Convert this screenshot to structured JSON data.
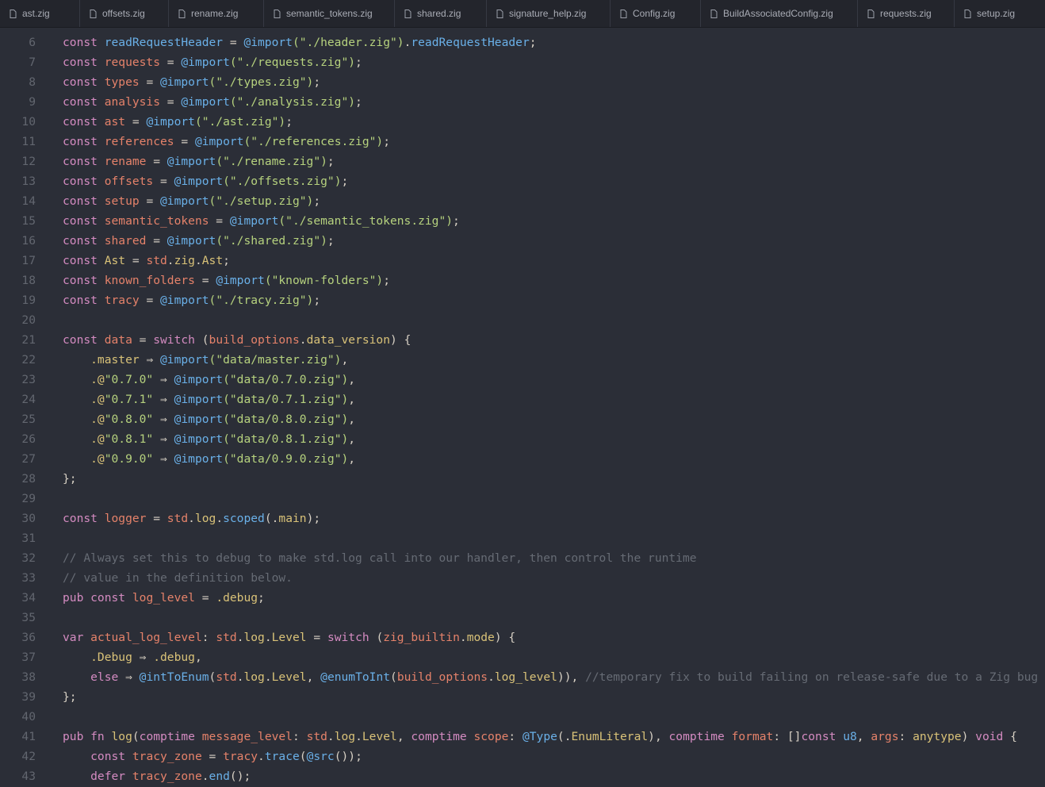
{
  "tabs": [
    {
      "label": "ast.zig"
    },
    {
      "label": "offsets.zig"
    },
    {
      "label": "rename.zig"
    },
    {
      "label": "semantic_tokens.zig"
    },
    {
      "label": "shared.zig"
    },
    {
      "label": "signature_help.zig"
    },
    {
      "label": "Config.zig"
    },
    {
      "label": "BuildAssociatedConfig.zig"
    },
    {
      "label": "requests.zig"
    },
    {
      "label": "setup.zig"
    }
  ],
  "colors": {
    "background": "#2b2e37",
    "tabbar": "#23252c",
    "keyword": "#d48bc1",
    "variable": "#e5826a",
    "function": "#6ab0e8",
    "string": "#b6d27e",
    "comment": "#666b74",
    "line_number": "#62666f"
  },
  "icons": {
    "tab_file": "file-icon"
  },
  "editor": {
    "lines": [
      {
        "n": "6",
        "tokens": [
          [
            "const ",
            "k"
          ],
          [
            "readRequestHeader",
            "f"
          ],
          [
            " = ",
            "p"
          ],
          [
            "@import",
            "f"
          ],
          [
            "(\"./header.zig\")",
            "s"
          ],
          [
            ".",
            "p"
          ],
          [
            "readRequestHeader",
            "f"
          ],
          [
            ";",
            "p"
          ]
        ]
      },
      {
        "n": "7",
        "tokens": [
          [
            "const ",
            "k"
          ],
          [
            "requests",
            "v"
          ],
          [
            " = ",
            "p"
          ],
          [
            "@import",
            "f"
          ],
          [
            "(\"./requests.zig\")",
            "s"
          ],
          [
            ";",
            "p"
          ]
        ]
      },
      {
        "n": "8",
        "tokens": [
          [
            "const ",
            "k"
          ],
          [
            "types",
            "v"
          ],
          [
            " = ",
            "p"
          ],
          [
            "@import",
            "f"
          ],
          [
            "(\"./types.zig\")",
            "s"
          ],
          [
            ";",
            "p"
          ]
        ]
      },
      {
        "n": "9",
        "tokens": [
          [
            "const ",
            "k"
          ],
          [
            "analysis",
            "v"
          ],
          [
            " = ",
            "p"
          ],
          [
            "@import",
            "f"
          ],
          [
            "(\"./analysis.zig\")",
            "s"
          ],
          [
            ";",
            "p"
          ]
        ]
      },
      {
        "n": "10",
        "tokens": [
          [
            "const ",
            "k"
          ],
          [
            "ast",
            "v"
          ],
          [
            " = ",
            "p"
          ],
          [
            "@import",
            "f"
          ],
          [
            "(\"./ast.zig\")",
            "s"
          ],
          [
            ";",
            "p"
          ]
        ]
      },
      {
        "n": "11",
        "tokens": [
          [
            "const ",
            "k"
          ],
          [
            "references",
            "v"
          ],
          [
            " = ",
            "p"
          ],
          [
            "@import",
            "f"
          ],
          [
            "(\"./references.zig\")",
            "s"
          ],
          [
            ";",
            "p"
          ]
        ]
      },
      {
        "n": "12",
        "tokens": [
          [
            "const ",
            "k"
          ],
          [
            "rename",
            "v"
          ],
          [
            " = ",
            "p"
          ],
          [
            "@import",
            "f"
          ],
          [
            "(\"./rename.zig\")",
            "s"
          ],
          [
            ";",
            "p"
          ]
        ]
      },
      {
        "n": "13",
        "tokens": [
          [
            "const ",
            "k"
          ],
          [
            "offsets",
            "v"
          ],
          [
            " = ",
            "p"
          ],
          [
            "@import",
            "f"
          ],
          [
            "(\"./offsets.zig\")",
            "s"
          ],
          [
            ";",
            "p"
          ]
        ]
      },
      {
        "n": "14",
        "tokens": [
          [
            "const ",
            "k"
          ],
          [
            "setup",
            "v"
          ],
          [
            " = ",
            "p"
          ],
          [
            "@import",
            "f"
          ],
          [
            "(\"./setup.zig\")",
            "s"
          ],
          [
            ";",
            "p"
          ]
        ]
      },
      {
        "n": "15",
        "tokens": [
          [
            "const ",
            "k"
          ],
          [
            "semantic_tokens",
            "v"
          ],
          [
            " = ",
            "p"
          ],
          [
            "@import",
            "f"
          ],
          [
            "(\"./semantic_tokens.zig\")",
            "s"
          ],
          [
            ";",
            "p"
          ]
        ]
      },
      {
        "n": "16",
        "tokens": [
          [
            "const ",
            "k"
          ],
          [
            "shared",
            "v"
          ],
          [
            " = ",
            "p"
          ],
          [
            "@import",
            "f"
          ],
          [
            "(\"./shared.zig\")",
            "s"
          ],
          [
            ";",
            "p"
          ]
        ]
      },
      {
        "n": "17",
        "tokens": [
          [
            "const ",
            "k"
          ],
          [
            "Ast",
            "t"
          ],
          [
            " = ",
            "p"
          ],
          [
            "std",
            "v"
          ],
          [
            ".",
            "p"
          ],
          [
            "zig",
            "t"
          ],
          [
            ".",
            "p"
          ],
          [
            "Ast",
            "t"
          ],
          [
            ";",
            "p"
          ]
        ]
      },
      {
        "n": "18",
        "tokens": [
          [
            "const ",
            "k"
          ],
          [
            "known_folders",
            "v"
          ],
          [
            " = ",
            "p"
          ],
          [
            "@import",
            "f"
          ],
          [
            "(\"known-folders\")",
            "s"
          ],
          [
            ";",
            "p"
          ]
        ]
      },
      {
        "n": "19",
        "tokens": [
          [
            "const ",
            "k"
          ],
          [
            "tracy",
            "v"
          ],
          [
            " = ",
            "p"
          ],
          [
            "@import",
            "f"
          ],
          [
            "(\"./tracy.zig\")",
            "s"
          ],
          [
            ";",
            "p"
          ]
        ]
      },
      {
        "n": "20",
        "tokens": []
      },
      {
        "n": "21",
        "tokens": [
          [
            "const ",
            "k"
          ],
          [
            "data",
            "v"
          ],
          [
            " = ",
            "p"
          ],
          [
            "switch",
            "k"
          ],
          [
            " (",
            "p"
          ],
          [
            "build_options",
            "v"
          ],
          [
            ".",
            "p"
          ],
          [
            "data_version",
            "t"
          ],
          [
            ") {",
            "p"
          ]
        ]
      },
      {
        "n": "22",
        "tokens": [
          [
            "    .master",
            "t"
          ],
          [
            " ⇒ ",
            "p"
          ],
          [
            "@import",
            "f"
          ],
          [
            "(\"data/master.zig\")",
            "s"
          ],
          [
            ",",
            "p"
          ]
        ]
      },
      {
        "n": "23",
        "tokens": [
          [
            "    .@",
            "t"
          ],
          [
            "\"0.7.0\"",
            "s"
          ],
          [
            " ⇒ ",
            "p"
          ],
          [
            "@import",
            "f"
          ],
          [
            "(\"data/0.7.0.zig\")",
            "s"
          ],
          [
            ",",
            "p"
          ]
        ]
      },
      {
        "n": "24",
        "tokens": [
          [
            "    .@",
            "t"
          ],
          [
            "\"0.7.1\"",
            "s"
          ],
          [
            " ⇒ ",
            "p"
          ],
          [
            "@import",
            "f"
          ],
          [
            "(\"data/0.7.1.zig\")",
            "s"
          ],
          [
            ",",
            "p"
          ]
        ]
      },
      {
        "n": "25",
        "tokens": [
          [
            "    .@",
            "t"
          ],
          [
            "\"0.8.0\"",
            "s"
          ],
          [
            " ⇒ ",
            "p"
          ],
          [
            "@import",
            "f"
          ],
          [
            "(\"data/0.8.0.zig\")",
            "s"
          ],
          [
            ",",
            "p"
          ]
        ]
      },
      {
        "n": "26",
        "tokens": [
          [
            "    .@",
            "t"
          ],
          [
            "\"0.8.1\"",
            "s"
          ],
          [
            " ⇒ ",
            "p"
          ],
          [
            "@import",
            "f"
          ],
          [
            "(\"data/0.8.1.zig\")",
            "s"
          ],
          [
            ",",
            "p"
          ]
        ]
      },
      {
        "n": "27",
        "tokens": [
          [
            "    .@",
            "t"
          ],
          [
            "\"0.9.0\"",
            "s"
          ],
          [
            " ⇒ ",
            "p"
          ],
          [
            "@import",
            "f"
          ],
          [
            "(\"data/0.9.0.zig\")",
            "s"
          ],
          [
            ",",
            "p"
          ]
        ]
      },
      {
        "n": "28",
        "tokens": [
          [
            "};",
            "p"
          ]
        ]
      },
      {
        "n": "29",
        "tokens": []
      },
      {
        "n": "30",
        "tokens": [
          [
            "const ",
            "k"
          ],
          [
            "logger",
            "v"
          ],
          [
            " = ",
            "p"
          ],
          [
            "std",
            "v"
          ],
          [
            ".",
            "p"
          ],
          [
            "log",
            "t"
          ],
          [
            ".",
            "p"
          ],
          [
            "scoped",
            "f"
          ],
          [
            "(.",
            "p"
          ],
          [
            "main",
            "t"
          ],
          [
            ");",
            "p"
          ]
        ]
      },
      {
        "n": "31",
        "tokens": []
      },
      {
        "n": "32",
        "tokens": [
          [
            "// Always set this to debug to make std.log call into our handler, then control the runtime",
            "c"
          ]
        ]
      },
      {
        "n": "33",
        "tokens": [
          [
            "// value in the definition below.",
            "c"
          ]
        ]
      },
      {
        "n": "34",
        "tokens": [
          [
            "pub const ",
            "k"
          ],
          [
            "log_level",
            "v"
          ],
          [
            " = ",
            "p"
          ],
          [
            ".debug",
            "t"
          ],
          [
            ";",
            "p"
          ]
        ]
      },
      {
        "n": "35",
        "tokens": []
      },
      {
        "n": "36",
        "tokens": [
          [
            "var ",
            "k"
          ],
          [
            "actual_log_level",
            "v"
          ],
          [
            ": ",
            "p"
          ],
          [
            "std",
            "v"
          ],
          [
            ".",
            "p"
          ],
          [
            "log",
            "t"
          ],
          [
            ".",
            "p"
          ],
          [
            "Level",
            "t"
          ],
          [
            " = ",
            "p"
          ],
          [
            "switch",
            "k"
          ],
          [
            " (",
            "p"
          ],
          [
            "zig_builtin",
            "v"
          ],
          [
            ".",
            "p"
          ],
          [
            "mode",
            "t"
          ],
          [
            ") {",
            "p"
          ]
        ]
      },
      {
        "n": "37",
        "tokens": [
          [
            "    .Debug",
            "t"
          ],
          [
            " ⇒ ",
            "p"
          ],
          [
            ".debug",
            "t"
          ],
          [
            ",",
            "p"
          ]
        ]
      },
      {
        "n": "38",
        "tokens": [
          [
            "    else",
            "k"
          ],
          [
            " ⇒ ",
            "p"
          ],
          [
            "@intToEnum",
            "f"
          ],
          [
            "(",
            "p"
          ],
          [
            "std",
            "v"
          ],
          [
            ".",
            "p"
          ],
          [
            "log",
            "t"
          ],
          [
            ".",
            "p"
          ],
          [
            "Level",
            "t"
          ],
          [
            ", ",
            "p"
          ],
          [
            "@enumToInt",
            "f"
          ],
          [
            "(",
            "p"
          ],
          [
            "build_options",
            "v"
          ],
          [
            ".",
            "p"
          ],
          [
            "log_level",
            "t"
          ],
          [
            ")), ",
            "p"
          ],
          [
            "//temporary fix to build failing on release-safe due to a Zig bug",
            "c"
          ]
        ]
      },
      {
        "n": "39",
        "tokens": [
          [
            "};",
            "p"
          ]
        ]
      },
      {
        "n": "40",
        "tokens": []
      },
      {
        "n": "41",
        "tokens": [
          [
            "pub fn ",
            "k"
          ],
          [
            "log",
            "t"
          ],
          [
            "(",
            "p"
          ],
          [
            "comptime ",
            "k"
          ],
          [
            "message_level",
            "v"
          ],
          [
            ": ",
            "p"
          ],
          [
            "std",
            "v"
          ],
          [
            ".",
            "p"
          ],
          [
            "log",
            "t"
          ],
          [
            ".",
            "p"
          ],
          [
            "Level",
            "t"
          ],
          [
            ", ",
            "p"
          ],
          [
            "comptime ",
            "k"
          ],
          [
            "scope",
            "v"
          ],
          [
            ": ",
            "p"
          ],
          [
            "@Type",
            "f"
          ],
          [
            "(.",
            "p"
          ],
          [
            "EnumLiteral",
            "t"
          ],
          [
            "), ",
            "p"
          ],
          [
            "comptime ",
            "k"
          ],
          [
            "format",
            "v"
          ],
          [
            ": ",
            "p"
          ],
          [
            "[]",
            "p"
          ],
          [
            "const ",
            "k"
          ],
          [
            "u8",
            "f"
          ],
          [
            ", ",
            "p"
          ],
          [
            "args",
            "v"
          ],
          [
            ": ",
            "p"
          ],
          [
            "anytype",
            "t"
          ],
          [
            ") ",
            "p"
          ],
          [
            "void",
            "k"
          ],
          [
            " {",
            "p"
          ]
        ]
      },
      {
        "n": "42",
        "tokens": [
          [
            "    const ",
            "k"
          ],
          [
            "tracy_zone",
            "v"
          ],
          [
            " = ",
            "p"
          ],
          [
            "tracy",
            "v"
          ],
          [
            ".",
            "p"
          ],
          [
            "trace",
            "f"
          ],
          [
            "(",
            "p"
          ],
          [
            "@src",
            "f"
          ],
          [
            "());",
            "p"
          ]
        ]
      },
      {
        "n": "43",
        "tokens": [
          [
            "    defer ",
            "k"
          ],
          [
            "tracy_zone",
            "v"
          ],
          [
            ".",
            "p"
          ],
          [
            "end",
            "f"
          ],
          [
            "();",
            "p"
          ]
        ]
      }
    ]
  }
}
